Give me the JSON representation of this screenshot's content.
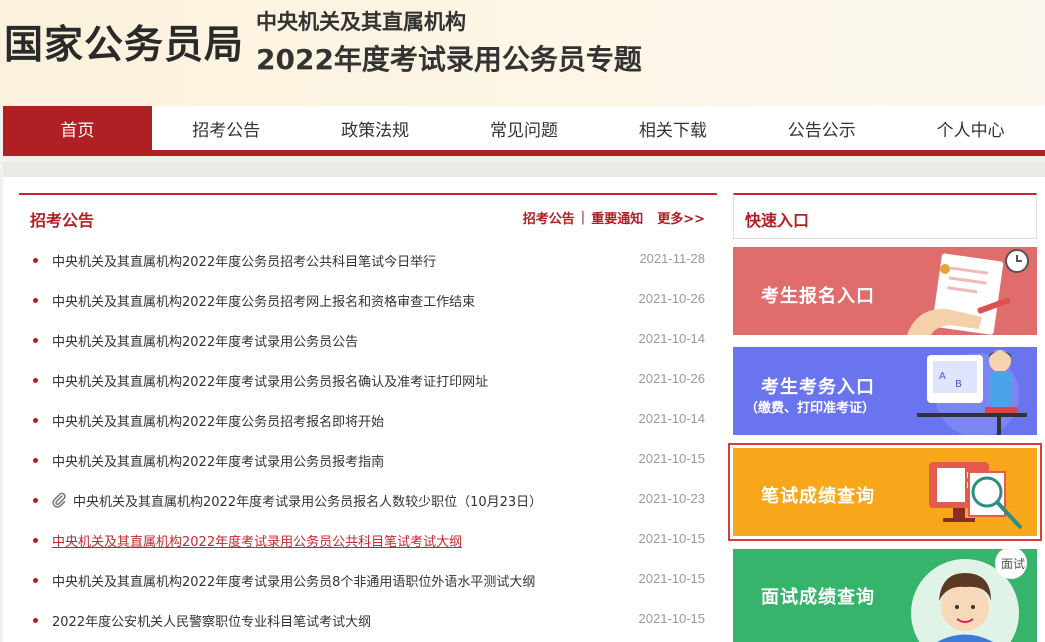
{
  "header": {
    "logo": "国家公务员局",
    "subtitle1": "中央机关及其直属机构",
    "subtitle2": "2022年度考试录用公务员专题"
  },
  "nav": {
    "items": [
      "首页",
      "招考公告",
      "政策法规",
      "常见问题",
      "相关下载",
      "公告公示",
      "个人中心"
    ],
    "active": "首页"
  },
  "notices": {
    "title": "招考公告",
    "link1": "招考公告",
    "separator": "|",
    "link2": "重要通知",
    "more": "更多>>",
    "items": [
      {
        "title": "中央机关及其直属机构2022年度公务员招考公共科目笔试今日举行",
        "date": "2021-11-28"
      },
      {
        "title": "中央机关及其直属机构2022年度公务员招考网上报名和资格审查工作结束",
        "date": "2021-10-26"
      },
      {
        "title": "中央机关及其直属机构2022年度考试录用公务员公告",
        "date": "2021-10-14"
      },
      {
        "title": "中央机关及其直属机构2022年度考试录用公务员报名确认及准考证打印网址",
        "date": "2021-10-26"
      },
      {
        "title": "中央机关及其直属机构2022年度公务员招考报名即将开始",
        "date": "2021-10-14"
      },
      {
        "title": "中央机关及其直属机构2022年度考试录用公务员报考指南",
        "date": "2021-10-15"
      },
      {
        "title": "中央机关及其直属机构2022年度考试录用公务员报名人数较少职位（10月23日）",
        "date": "2021-10-23"
      },
      {
        "title": "中央机关及其直属机构2022年度考试录用公务员公共科目笔试考试大纲",
        "date": "2021-10-15"
      },
      {
        "title": "中央机关及其直属机构2022年度考试录用公务员8个非通用语职位外语水平测试大纲",
        "date": "2021-10-15"
      },
      {
        "title": "2022年度公安机关人民警察职位专业科目笔试考试大纲",
        "date": "2021-10-15"
      }
    ]
  },
  "quick": {
    "title": "快速入口",
    "cards": [
      {
        "label": "考生报名入口"
      },
      {
        "label": "考生考务入口",
        "sub": "（缴费、打印准考证）"
      },
      {
        "label": "笔试成绩查询"
      },
      {
        "label": "面试成绩查询",
        "bubble": "面试"
      }
    ]
  }
}
